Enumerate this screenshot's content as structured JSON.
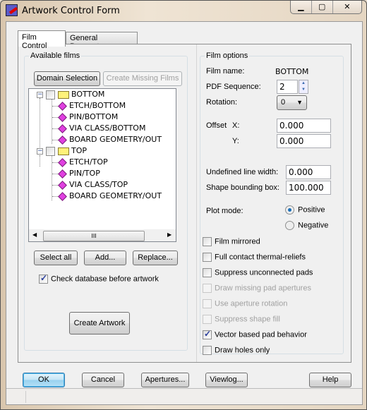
{
  "window": {
    "title": "Artwork Control Form",
    "controls": [
      "▁",
      "▢",
      "✕"
    ]
  },
  "tabs": [
    {
      "label": "Film Control",
      "active": true
    },
    {
      "label": "General Parameters",
      "active": false
    }
  ],
  "available_films": {
    "label": "Available films",
    "domain_selection": "Domain Selection",
    "create_missing": "Create Missing Films",
    "tree": [
      {
        "label": "BOTTOM",
        "children": [
          "ETCH/BOTTOM",
          "PIN/BOTTOM",
          "VIA CLASS/BOTTOM",
          "BOARD GEOMETRY/OUT"
        ]
      },
      {
        "label": "TOP",
        "children": [
          "ETCH/TOP",
          "PIN/TOP",
          "VIA CLASS/TOP",
          "BOARD GEOMETRY/OUT"
        ]
      }
    ],
    "scroll_thumb": "III",
    "select_all": "Select all",
    "add": "Add...",
    "replace": "Replace...",
    "check_db": {
      "label": "Check database before artwork",
      "checked": true
    },
    "create_artwork": "Create Artwork"
  },
  "film_options": {
    "label": "Film options",
    "film_name_label": "Film name:",
    "film_name": "BOTTOM",
    "pdf_seq_label": "PDF Sequence:",
    "pdf_seq": "2",
    "rotation_label": "Rotation:",
    "rotation": "0",
    "offset_label": "Offset",
    "x_label": "X:",
    "x": "0.000",
    "y_label": "Y:",
    "y": "0.000",
    "undef_label": "Undefined line width:",
    "undef": "0.000",
    "shape_label": "Shape bounding box:",
    "shape": "100.000",
    "plot_mode_label": "Plot mode:",
    "positive": "Positive",
    "negative": "Negative",
    "plot_mode": "Positive",
    "checks": [
      {
        "label": "Film mirrored",
        "checked": false,
        "enabled": true
      },
      {
        "label": "Full contact thermal-reliefs",
        "checked": false,
        "enabled": true
      },
      {
        "label": "Suppress unconnected pads",
        "checked": false,
        "enabled": true
      },
      {
        "label": "Draw missing pad apertures",
        "checked": false,
        "enabled": false
      },
      {
        "label": "Use aperture rotation",
        "checked": false,
        "enabled": false
      },
      {
        "label": "Suppress shape fill",
        "checked": false,
        "enabled": false
      },
      {
        "label": "Vector based pad behavior",
        "checked": true,
        "enabled": true
      },
      {
        "label": "Draw holes only",
        "checked": false,
        "enabled": true
      }
    ]
  },
  "footer": {
    "ok": "OK",
    "cancel": "Cancel",
    "apertures": "Apertures...",
    "viewlog": "Viewlog...",
    "help": "Help"
  }
}
